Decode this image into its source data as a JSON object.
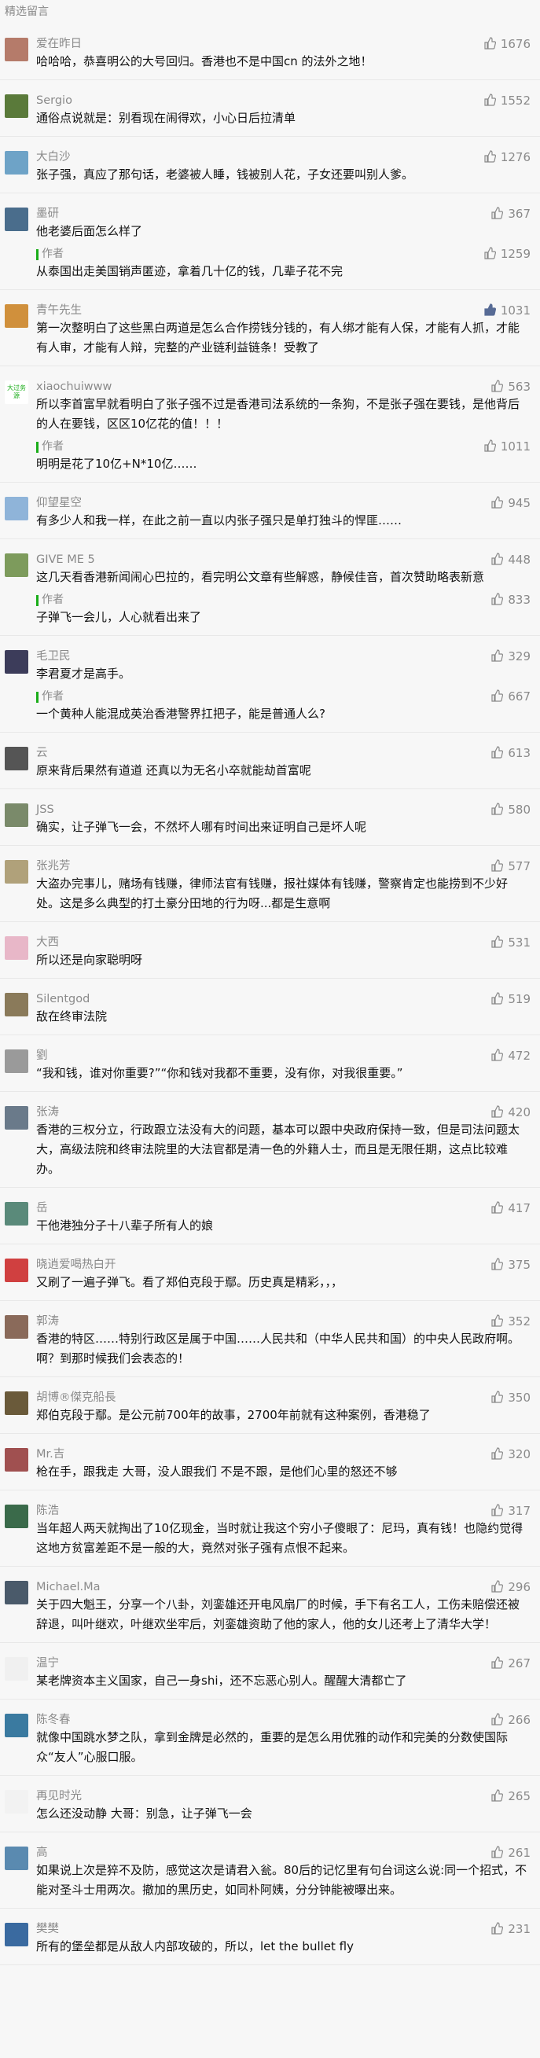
{
  "section_title": "精选留言",
  "reply_label": "作者",
  "comments": [
    {
      "nickname": "爱在昨日",
      "likes": "1676",
      "text": "哈哈哈，恭喜明公的大号回归。香港也不是中国cn 的法外之地！",
      "avatar_color": "#b57b6a"
    },
    {
      "nickname": "Sergio",
      "likes": "1552",
      "text": "通俗点说就是：别看现在闹得欢，小心日后拉清单",
      "avatar_color": "#5a7a3a"
    },
    {
      "nickname": "大白沙",
      "likes": "1276",
      "text": "张子强，真应了那句话，老婆被人睡，钱被别人花，子女还要叫别人爹。",
      "avatar_color": "#6ea3c7"
    },
    {
      "nickname": "墨研",
      "likes": "367",
      "text": "他老婆后面怎么样了",
      "avatar_color": "#4a6d8c",
      "reply": {
        "likes": "1259",
        "text": "从泰国出走美国销声匿迹，拿着几十亿的钱，几辈子花不完"
      }
    },
    {
      "nickname": "青午先生",
      "likes": "1031",
      "text": "第一次整明白了这些黑白两道是怎么合作捞钱分钱的，有人绑才能有人保，才能有人抓，才能有人审，才能有人辩，完整的产业链利益链条！受教了",
      "avatar_color": "#d0903c",
      "liked": true
    },
    {
      "nickname": "xiaochuiwww",
      "likes": "563",
      "text": "所以李首富早就看明白了张子强不过是香港司法系统的一条狗，不是张子强在要钱，是他背后的人在要钱，区区10亿花的值！！！",
      "avatar_color": "#ffffff",
      "avatar_text": "大过务源",
      "reply": {
        "likes": "1011",
        "text": "明明是花了10亿+N*10亿……"
      }
    },
    {
      "nickname": "仰望星空",
      "likes": "945",
      "text": "有多少人和我一样，在此之前一直以内张子强只是单打独斗的悍匪……",
      "avatar_color": "#8fb4d9"
    },
    {
      "nickname": "GIVE ME 5",
      "likes": "448",
      "text": "这几天看香港新闻闹心巴拉的，看完明公文章有些解惑，静候佳音，首次赞助略表新意",
      "avatar_color": "#7d9b5c",
      "reply": {
        "likes": "833",
        "text": "子弹飞一会儿，人心就看出来了"
      }
    },
    {
      "nickname": "毛卫民",
      "likes": "329",
      "text": "李君夏才是高手。",
      "avatar_color": "#3c3c5a",
      "reply": {
        "likes": "667",
        "text": "一个黄种人能混成英治香港警界扛把子，能是普通人么?"
      }
    },
    {
      "nickname": "云",
      "likes": "613",
      "text": "原来背后果然有道道 还真以为无名小卒就能劫首富呢",
      "avatar_color": "#555555"
    },
    {
      "nickname": "JSS",
      "likes": "580",
      "text": "确实，让子弹飞一会，不然坏人哪有时间出来证明自己是坏人呢",
      "avatar_color": "#7a8a6a"
    },
    {
      "nickname": "张兆芳",
      "likes": "577",
      "text": "大盗办完事儿，赌场有钱赚，律师法官有钱赚，报社媒体有钱赚，警察肯定也能捞到不少好处。这是多么典型的打土豪分田地的行为呀...都是生意啊",
      "avatar_color": "#b0a17a"
    },
    {
      "nickname": "大西",
      "likes": "531",
      "text": "所以还是向家聪明呀",
      "avatar_color": "#e8b7c8"
    },
    {
      "nickname": "Silentgod",
      "likes": "519",
      "text": "敌在终审法院",
      "avatar_color": "#8a7a5a"
    },
    {
      "nickname": "劉",
      "likes": "472",
      "text": "“我和钱，谁对你重要?”“你和钱对我都不重要，没有你，对我很重要。”",
      "avatar_color": "#9a9a9a"
    },
    {
      "nickname": "张涛",
      "likes": "420",
      "text": "香港的三权分立，行政跟立法没有大的问题，基本可以跟中央政府保持一致，但是司法问题太大，高级法院和终审法院里的大法官都是清一色的外籍人士，而且是无限任期，这点比较难办。",
      "avatar_color": "#6a7a8a"
    },
    {
      "nickname": "岳",
      "likes": "417",
      "text": "干他港独分子十八辈子所有人的娘",
      "avatar_color": "#5a8a7a"
    },
    {
      "nickname": "晓逍爱喝热白开",
      "likes": "375",
      "text": "又刷了一遍子弹飞。看了郑伯克段于鄢。历史真是精彩，，，",
      "avatar_color": "#d04040"
    },
    {
      "nickname": "郭涛",
      "likes": "352",
      "text": "香港的特区……特别行政区是属于中国……人民共和（中华人民共和国）的中央人民政府啊。啊？到那时候我们会表态的！",
      "avatar_color": "#8a6a5a"
    },
    {
      "nickname": "胡博®傑克船長",
      "likes": "350",
      "text": "郑伯克段于鄢。是公元前700年的故事，2700年前就有这种案例，香港稳了",
      "avatar_color": "#6a5a3a"
    },
    {
      "nickname": "Mr.吉",
      "likes": "320",
      "text": "枪在手，跟我走 大哥，没人跟我们 不是不跟，是他们心里的怒还不够",
      "avatar_color": "#a05050"
    },
    {
      "nickname": "陈浩",
      "likes": "317",
      "text": "当年超人两天就掏出了10亿现金，当时就让我这个穷小子傻眼了：尼玛，真有钱！也隐约觉得这地方贫富差距不是一般的大，竟然对张子强有点恨不起来。",
      "avatar_color": "#3a6a4a"
    },
    {
      "nickname": "Michael.Ma",
      "likes": "296",
      "text": "关于四大魁王，分享一个八卦，刘銮雄还开电风扇厂的时候，手下有名工人，工伤未赔偿还被辞退，叫叶继欢，叶继欢坐牢后，刘銮雄资助了他的家人，他的女儿还考上了清华大学！",
      "avatar_color": "#4a5a6a"
    },
    {
      "nickname": "温宁",
      "likes": "267",
      "text": "某老牌资本主义国家，自己一身shi，还不忘恶心别人。醒醒大清都亡了",
      "avatar_color": "#f0f0f0"
    },
    {
      "nickname": "陈冬春",
      "likes": "266",
      "text": "就像中国跳水梦之队，拿到金牌是必然的，重要的是怎么用优雅的动作和完美的分数使国际众“友人”心服口服。",
      "avatar_color": "#3a7aa0"
    },
    {
      "nickname": "再见时光",
      "likes": "265",
      "text": "怎么还没动静 大哥：别急，让子弹飞一会",
      "avatar_color": "#f2f2f2"
    },
    {
      "nickname": "高",
      "likes": "261",
      "text": "如果说上次是猝不及防，感觉这次是请君入瓮。80后的记忆里有句台词这么说:同一个招式，不能对圣斗士用两次。撤加的黑历史，如同朴阿姨，分分钟能被曝出来。",
      "avatar_color": "#5a8ab0"
    },
    {
      "nickname": "樊樊",
      "likes": "231",
      "text": "所有的堡垒都是从敌人内部攻破的，所以，let the bullet fly",
      "avatar_color": "#3a6aa0"
    }
  ]
}
